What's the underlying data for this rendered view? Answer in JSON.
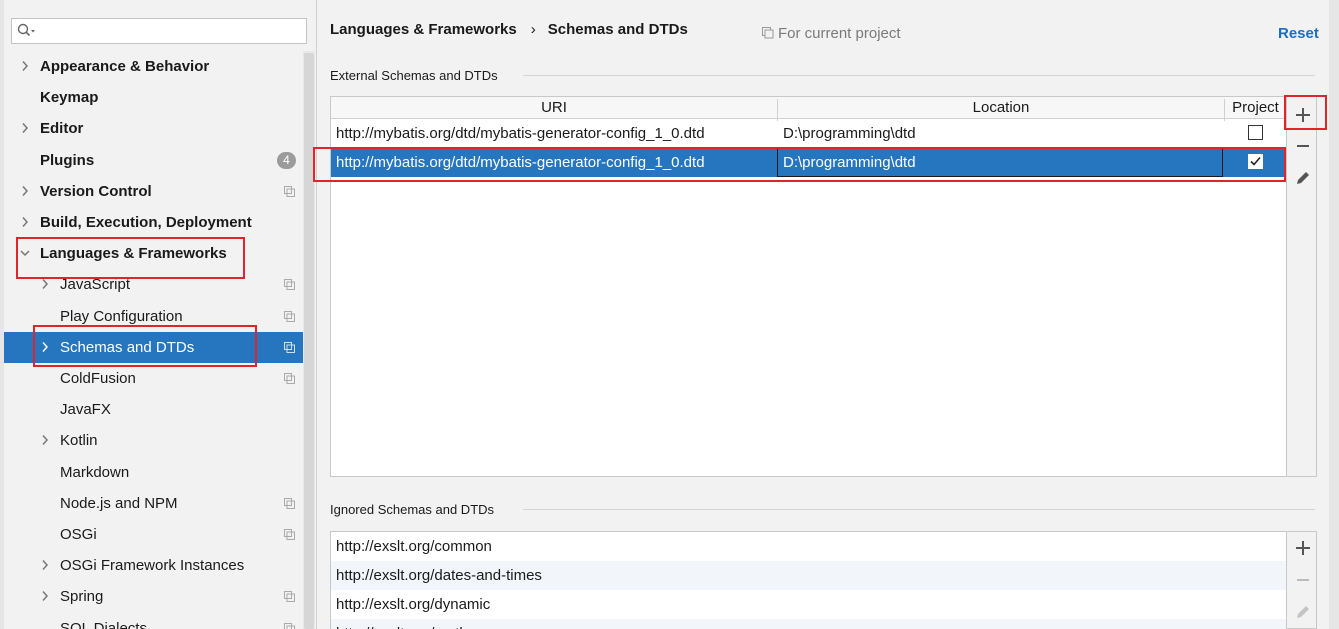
{
  "search": {
    "placeholder": ""
  },
  "tree": [
    {
      "label": "Appearance & Behavior",
      "bold": true,
      "arrow": "right",
      "indent": 0
    },
    {
      "label": "Keymap",
      "bold": true,
      "arrow": "",
      "indent": 0
    },
    {
      "label": "Editor",
      "bold": true,
      "arrow": "right",
      "indent": 0
    },
    {
      "label": "Plugins",
      "bold": true,
      "arrow": "",
      "indent": 0,
      "badge": "4"
    },
    {
      "label": "Version Control",
      "bold": true,
      "arrow": "right",
      "indent": 0,
      "copy": true
    },
    {
      "label": "Build, Execution, Deployment",
      "bold": true,
      "arrow": "right",
      "indent": 0
    },
    {
      "label": "Languages & Frameworks",
      "bold": true,
      "arrow": "down",
      "indent": 0
    },
    {
      "label": "JavaScript",
      "bold": false,
      "arrow": "right",
      "indent": 1,
      "copy": true
    },
    {
      "label": "Play Configuration",
      "bold": false,
      "arrow": "",
      "indent": 1,
      "copy": true
    },
    {
      "label": "Schemas and DTDs",
      "bold": false,
      "arrow": "right",
      "indent": 1,
      "copy": true,
      "selected": true
    },
    {
      "label": "ColdFusion",
      "bold": false,
      "arrow": "",
      "indent": 1,
      "copy": true
    },
    {
      "label": "JavaFX",
      "bold": false,
      "arrow": "",
      "indent": 1
    },
    {
      "label": "Kotlin",
      "bold": false,
      "arrow": "right",
      "indent": 1
    },
    {
      "label": "Markdown",
      "bold": false,
      "arrow": "",
      "indent": 1
    },
    {
      "label": "Node.js and NPM",
      "bold": false,
      "arrow": "",
      "indent": 1,
      "copy": true
    },
    {
      "label": "OSGi",
      "bold": false,
      "arrow": "",
      "indent": 1,
      "copy": true
    },
    {
      "label": "OSGi Framework Instances",
      "bold": false,
      "arrow": "right",
      "indent": 1
    },
    {
      "label": "Spring",
      "bold": false,
      "arrow": "right",
      "indent": 1,
      "copy": true
    },
    {
      "label": "SQL Dialects",
      "bold": false,
      "arrow": "",
      "indent": 1,
      "copy": true
    }
  ],
  "header": {
    "crumb_parent": "Languages & Frameworks",
    "crumb_separator": "›",
    "crumb_current": "Schemas and DTDs",
    "scope": "For current project",
    "reset": "Reset"
  },
  "external": {
    "title": "External Schemas and DTDs",
    "columns": {
      "uri": "URI",
      "location": "Location",
      "project": "Project"
    },
    "rows": [
      {
        "uri": "http://mybatis.org/dtd/mybatis-generator-config_1_0.dtd",
        "location": "D:\\programming\\dtd",
        "project": false
      },
      {
        "uri": "http://mybatis.org/dtd/mybatis-generator-config_1_0.dtd",
        "location": "D:\\programming\\dtd",
        "project": true
      }
    ]
  },
  "ignored": {
    "title": "Ignored Schemas and DTDs",
    "rows": [
      "http://exslt.org/common",
      "http://exslt.org/dates-and-times",
      "http://exslt.org/dynamic",
      "http://exslt.org/math"
    ]
  },
  "icons": {
    "search": "search-icon",
    "add": "add-icon",
    "remove": "remove-icon",
    "edit": "edit-icon",
    "copy": "project-scope-icon"
  },
  "colors": {
    "selection": "#2675bf",
    "link": "#1b6ec2",
    "highlight_box": "#e0242a"
  }
}
